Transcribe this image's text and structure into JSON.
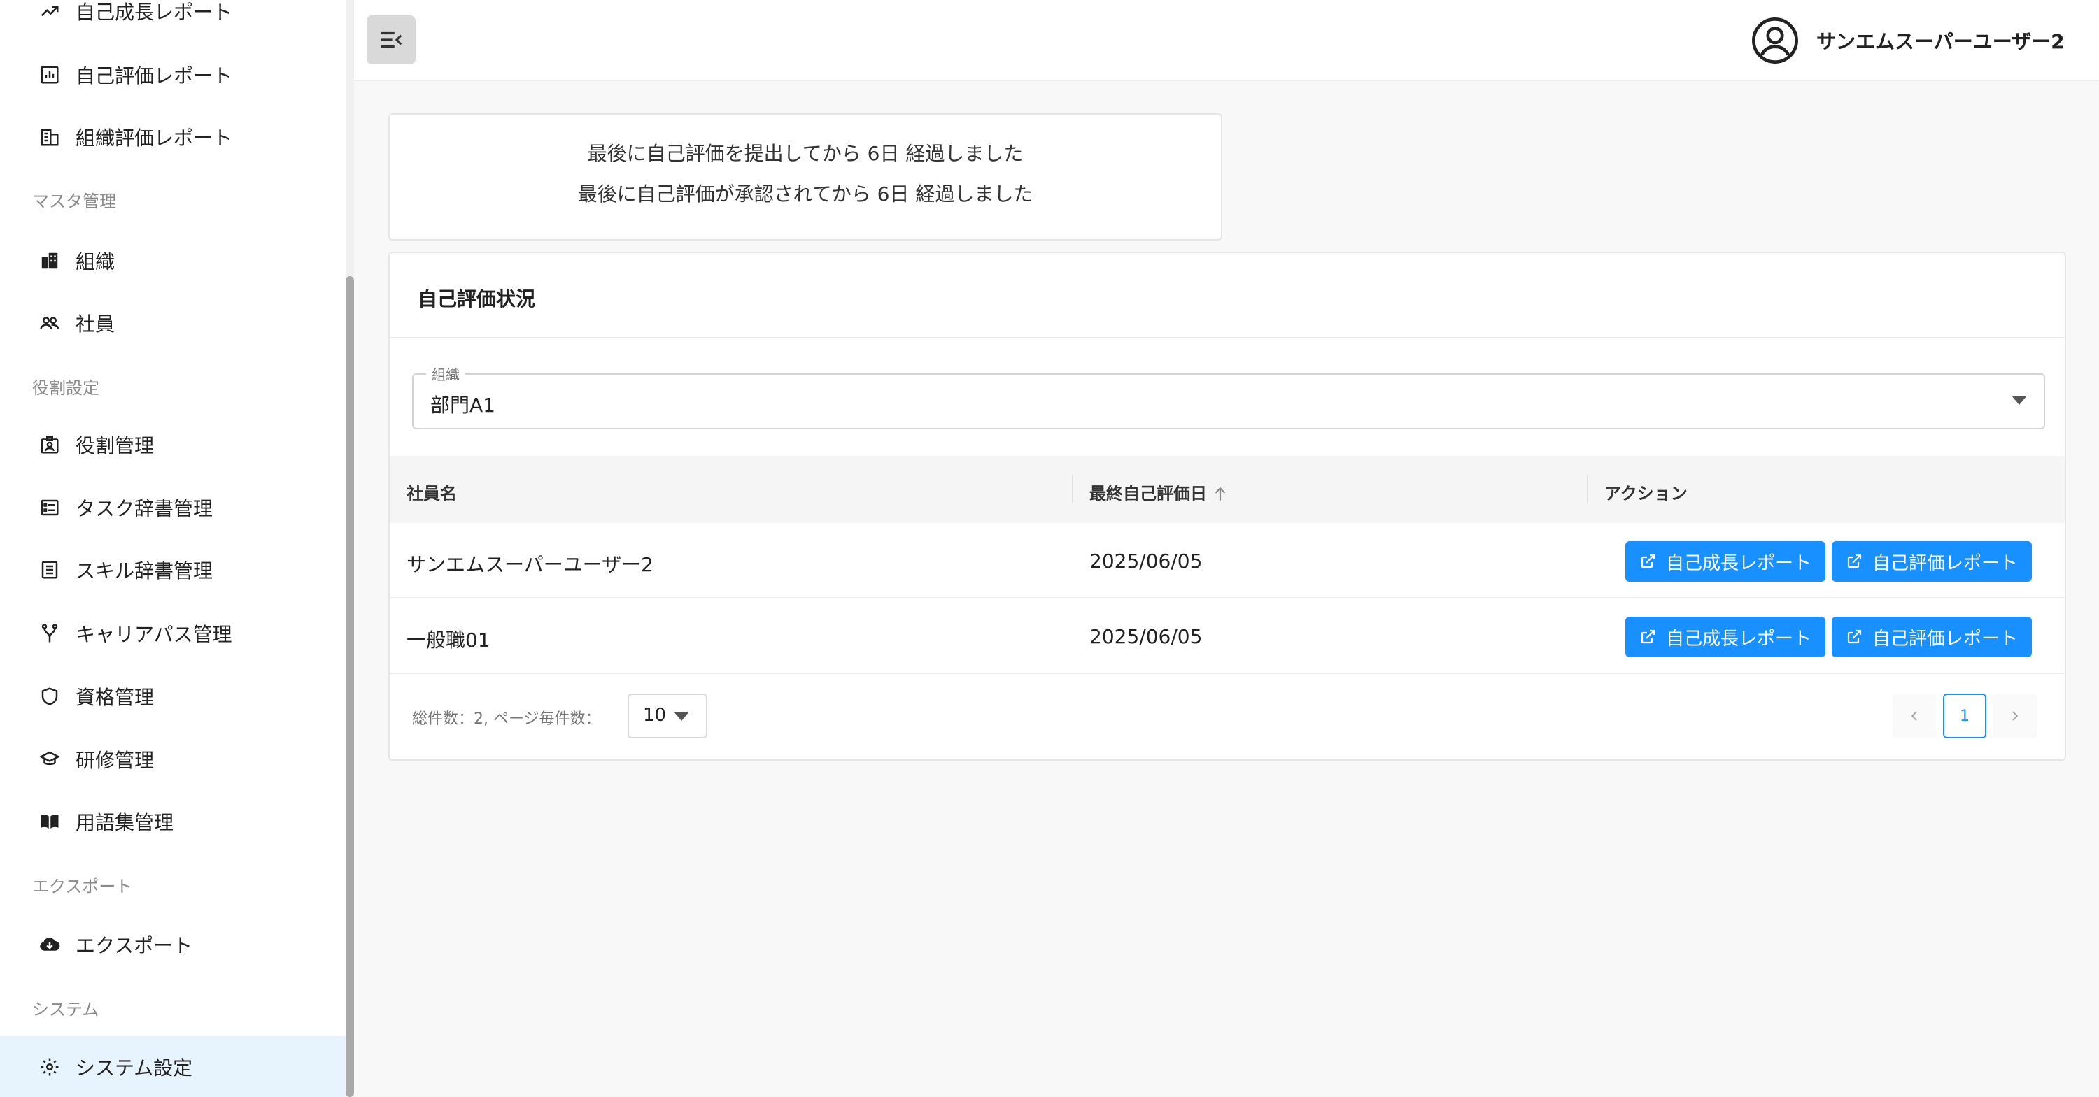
{
  "sidebar": {
    "items": [
      {
        "label": "自己成長レポート",
        "icon": "trend-up-icon"
      },
      {
        "label": "自己評価レポート",
        "icon": "bar-chart-icon"
      },
      {
        "label": "組織評価レポート",
        "icon": "building-icon"
      },
      {
        "label": "組織",
        "icon": "org-buildings-icon"
      },
      {
        "label": "社員",
        "icon": "people-icon"
      },
      {
        "label": "役割管理",
        "icon": "id-badge-icon"
      },
      {
        "label": "タスク辞書管理",
        "icon": "task-list-icon"
      },
      {
        "label": "スキル辞書管理",
        "icon": "list-icon"
      },
      {
        "label": "キャリアパス管理",
        "icon": "branch-icon"
      },
      {
        "label": "資格管理",
        "icon": "shield-icon"
      },
      {
        "label": "研修管理",
        "icon": "graduation-cap-icon"
      },
      {
        "label": "用語集管理",
        "icon": "book-icon"
      },
      {
        "label": "エクスポート",
        "icon": "cloud-download-icon"
      },
      {
        "label": "システム設定",
        "icon": "gear-icon"
      }
    ],
    "sections": [
      "マスタ管理",
      "役割設定",
      "エクスポート",
      "システム"
    ]
  },
  "header": {
    "user_name": "サンエムスーパーユーザー2",
    "menu_icon": "menu-collapse-icon",
    "avatar_icon": "user-circle-icon"
  },
  "notice": {
    "line1": "最後に自己評価を提出してから 6日 経過しました",
    "line2": "最後に自己評価が承認されてから 6日 経過しました"
  },
  "status_card": {
    "title": "自己評価状況",
    "org_select": {
      "label": "組織",
      "value": "部門A1"
    },
    "columns": [
      "社員名",
      "最終自己評価日",
      "アクション"
    ],
    "rows": [
      {
        "name": "サンエムスーパーユーザー2",
        "date": "2025/06/05",
        "btn_growth": "自己成長レポート",
        "btn_eval": "自己評価レポート"
      },
      {
        "name": "一般職01",
        "date": "2025/06/05",
        "btn_growth": "自己成長レポート",
        "btn_eval": "自己評価レポート"
      }
    ],
    "footer": {
      "total_text": "総件数：2,  ページ毎件数：",
      "page_size": "10",
      "current_page": "1"
    }
  },
  "colors": {
    "accent": "#1890ff",
    "active_nav_bg": "#e8f4fd"
  }
}
